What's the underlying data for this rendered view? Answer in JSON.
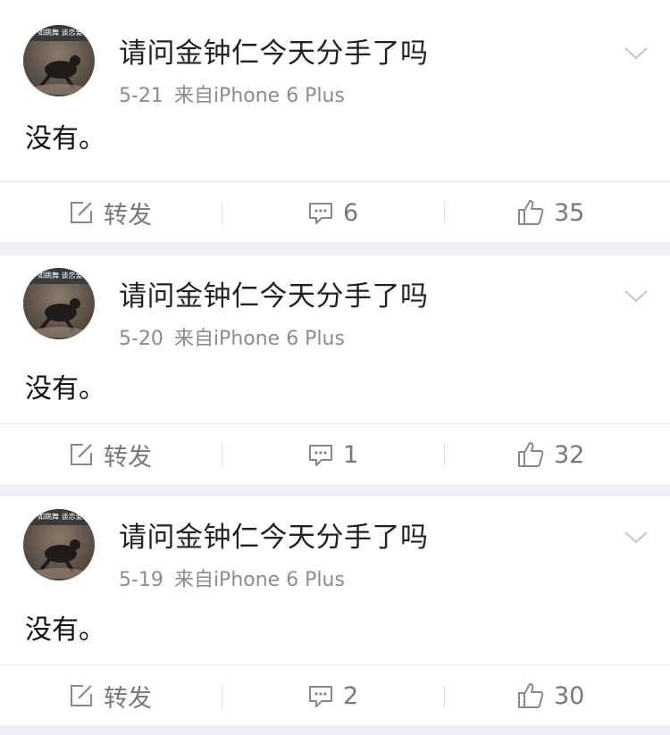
{
  "posts": [
    {
      "username": "请问金钟仁今天分手了吗",
      "date": "5-21",
      "source": "来自iPhone 6 Plus",
      "text": "没有。",
      "avatar_caption": "如跳舞 谈恋爱不如跳舞",
      "repost_label": "转发",
      "comments": "6",
      "likes": "35"
    },
    {
      "username": "请问金钟仁今天分手了吗",
      "date": "5-20",
      "source": "来自iPhone 6 Plus",
      "text": "没有。",
      "avatar_caption": "如跳舞 谈恋爱不如跳舞",
      "repost_label": "转发",
      "comments": "1",
      "likes": "32"
    },
    {
      "username": "请问金钟仁今天分手了吗",
      "date": "5-19",
      "source": "来自iPhone 6 Plus",
      "text": "没有。",
      "avatar_caption": "如跳舞 谈恋爱不如跳舞",
      "repost_label": "转发",
      "comments": "2",
      "likes": "30"
    }
  ],
  "icons": {
    "repost": "edit-square-icon",
    "comment": "comment-bubble-icon",
    "like": "thumbs-up-icon",
    "menu": "chevron-down-icon"
  },
  "colors": {
    "background": "#efeff3",
    "card": "#ffffff",
    "text_primary": "#222222",
    "text_meta": "#8c8c8c",
    "icon": "#777777"
  }
}
